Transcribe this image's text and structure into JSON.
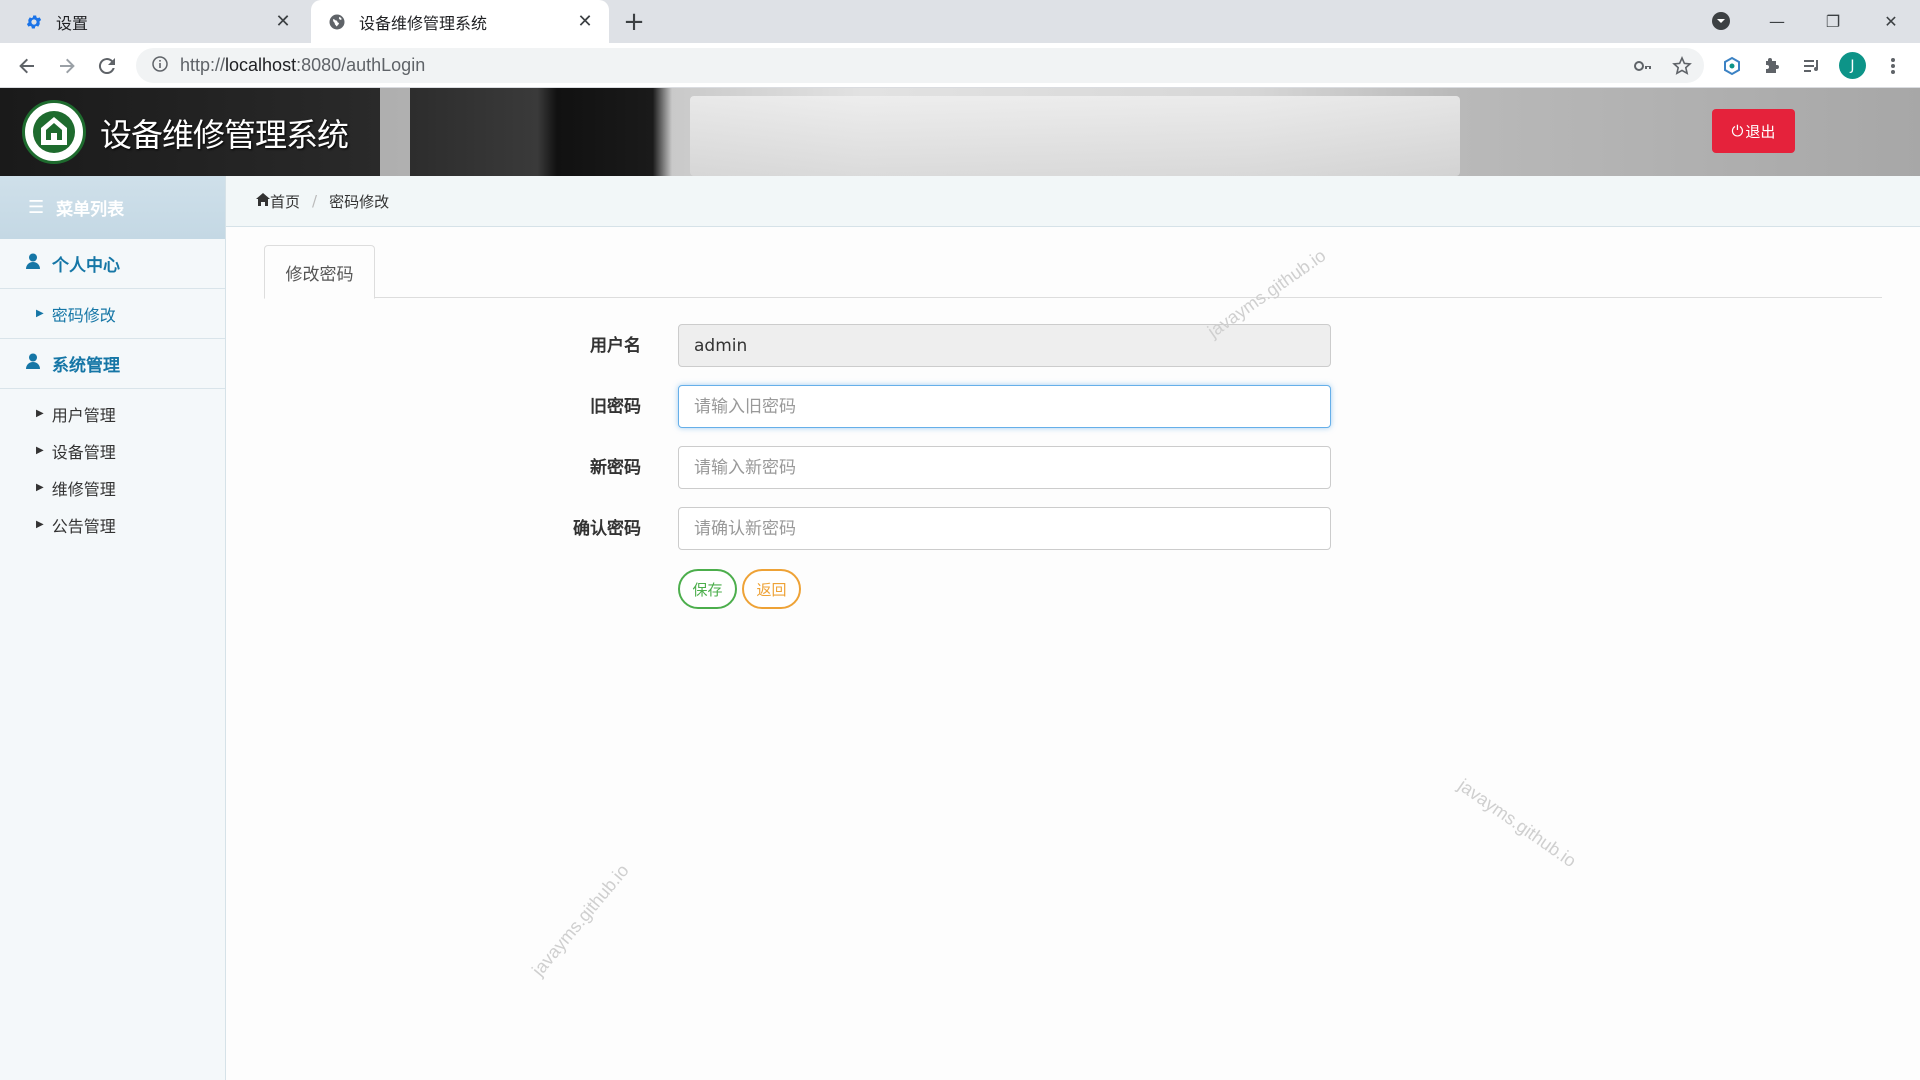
{
  "browser": {
    "tabs": [
      {
        "title": "设置",
        "icon": "gear-icon",
        "active": false
      },
      {
        "title": "设备维修管理系统",
        "icon": "globe-icon",
        "active": true
      }
    ],
    "url_prefix": "http://",
    "url_host": "localhost",
    "url_rest": ":8080/authLogin",
    "profile_initial": "J"
  },
  "header": {
    "title": "设备维修管理系统",
    "logout_label": "退出",
    "logout_color": "#e5223b"
  },
  "sidebar": {
    "menu_title": "菜单列表",
    "groups": [
      {
        "label": "个人中心",
        "items": [
          {
            "label": "密码修改",
            "active": true
          }
        ]
      },
      {
        "label": "系统管理",
        "items": [
          {
            "label": "用户管理"
          },
          {
            "label": "设备管理"
          },
          {
            "label": "维修管理"
          },
          {
            "label": "公告管理"
          }
        ]
      }
    ]
  },
  "breadcrumb": {
    "home": "首页",
    "current": "密码修改"
  },
  "form": {
    "tab_label": "修改密码",
    "fields": [
      {
        "label": "用户名",
        "value": "admin",
        "placeholder": ""
      },
      {
        "label": "旧密码",
        "value": "",
        "placeholder": "请输入旧密码"
      },
      {
        "label": "新密码",
        "value": "",
        "placeholder": "请输入新密码"
      },
      {
        "label": "确认密码",
        "value": "",
        "placeholder": "请确认新密码"
      }
    ],
    "save_label": "保存",
    "back_label": "返回"
  },
  "watermark": "javayms.github.io"
}
